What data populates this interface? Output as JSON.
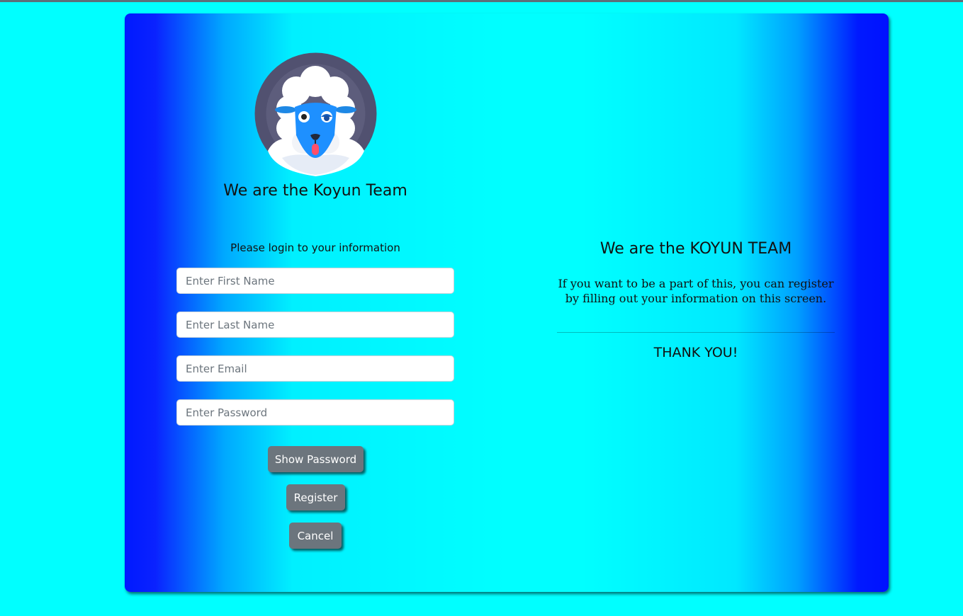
{
  "left": {
    "heading": "We are the Koyun Team",
    "login_prompt": "Please login to your information",
    "fields": {
      "first_name": {
        "placeholder": "Enter First Name",
        "value": ""
      },
      "last_name": {
        "placeholder": "Enter Last Name",
        "value": ""
      },
      "email": {
        "placeholder": "Enter Email",
        "value": ""
      },
      "password": {
        "placeholder": "Enter Password",
        "value": ""
      }
    },
    "buttons": {
      "show_password": "Show Password",
      "register": "Register",
      "cancel": "Cancel"
    }
  },
  "right": {
    "title": "We are the KOYUN TEAM",
    "text": "If you want to be a part of this, you can register by filling out your information on this screen.",
    "thanks": "THANK YOU!"
  },
  "colors": {
    "page_background": "#00ffff",
    "gradient_edge": "#0019ff",
    "button": "#6c757d"
  },
  "icons": {
    "avatar": "sheep-avatar-icon"
  }
}
